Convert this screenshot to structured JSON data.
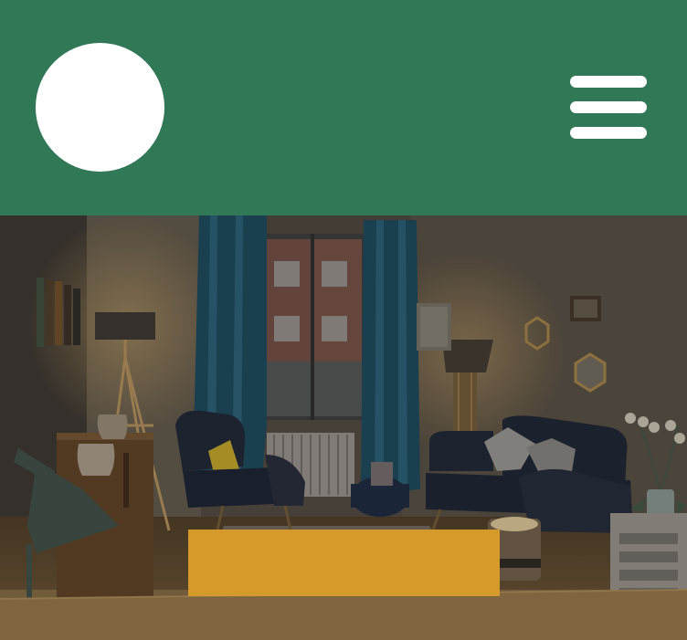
{
  "header": {
    "background_color": "#317857",
    "logo": {
      "shape": "circle",
      "color": "#ffffff"
    },
    "menu": {
      "icon": "hamburger-menu-icon",
      "color": "#ffffff"
    }
  },
  "hero": {
    "image": "living-room-photo",
    "overlay": "dark-tint"
  },
  "cta": {
    "label": "",
    "color": "#d69a2a"
  }
}
